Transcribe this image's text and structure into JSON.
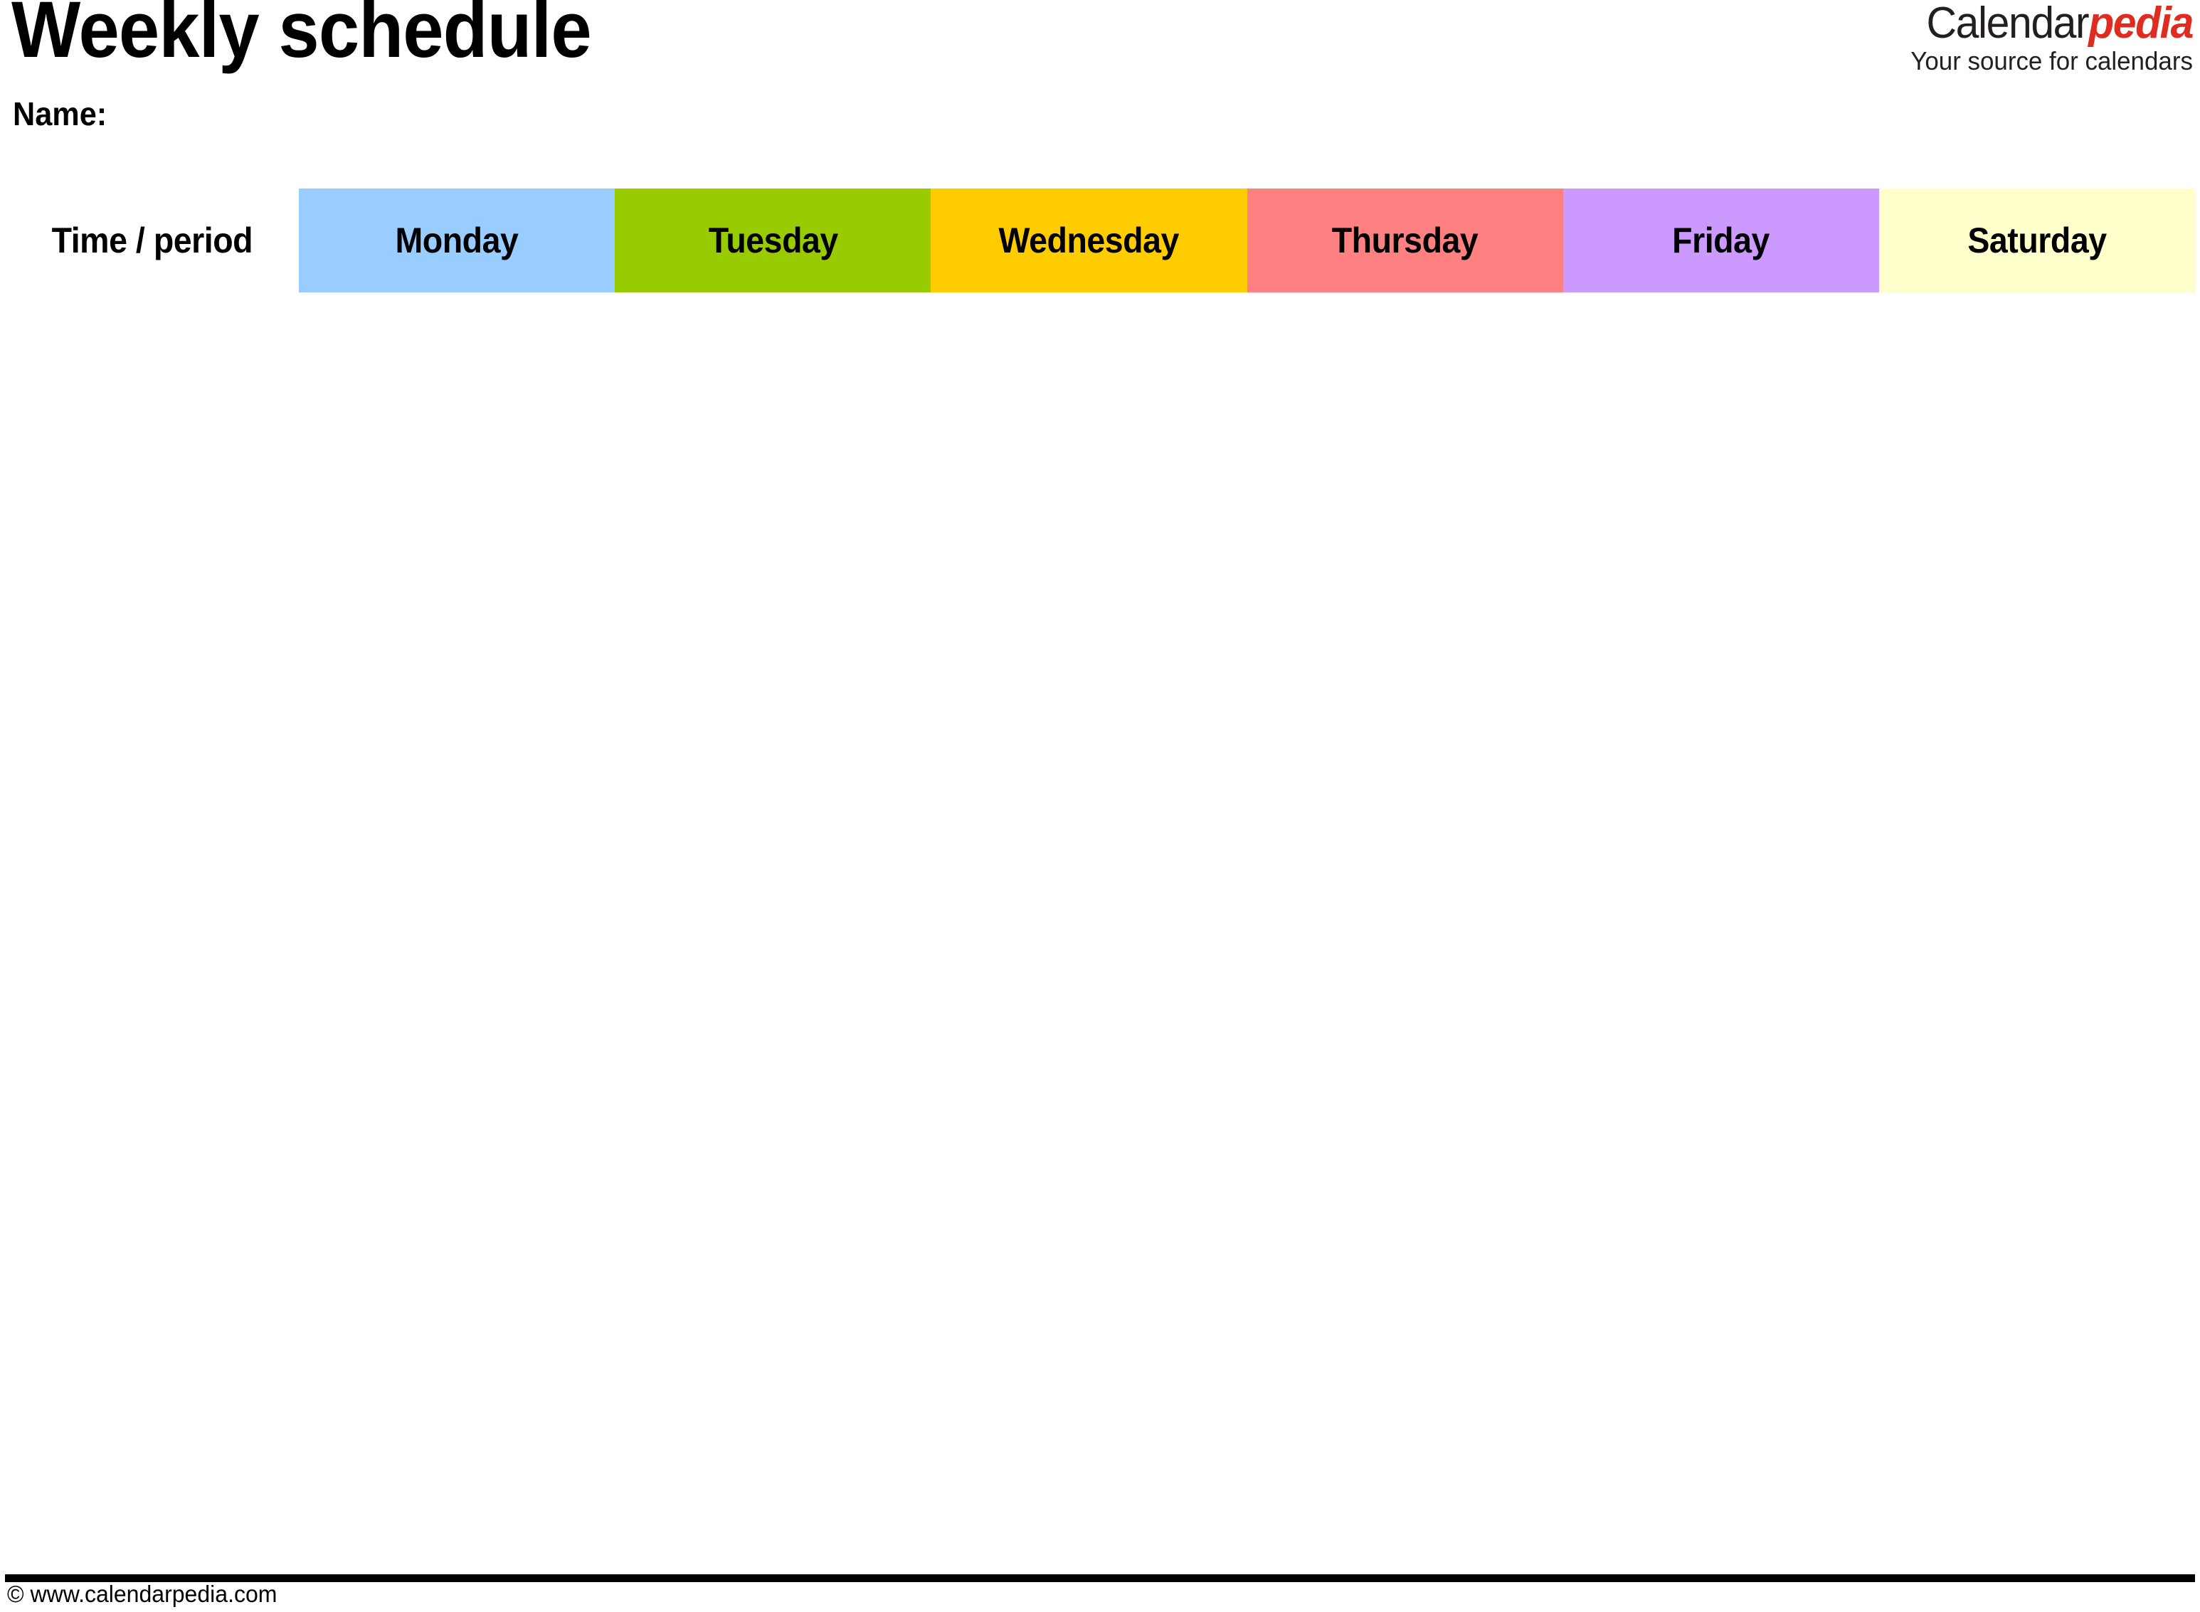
{
  "document": {
    "title": "Weekly schedule",
    "name_label": "Name:"
  },
  "brand": {
    "name_part1": "Calendar",
    "name_part2": "pedia",
    "tagline": "Your source for calendars",
    "accent_color": "#e02b20",
    "text_color": "#231f20"
  },
  "table": {
    "columns": [
      {
        "label": "Time / period",
        "bg": "#ffffff"
      },
      {
        "label": "Monday",
        "bg": "#99ccff"
      },
      {
        "label": "Tuesday",
        "bg": "#99cc00"
      },
      {
        "label": "Wednesday",
        "bg": "#ffcc00"
      },
      {
        "label": "Thursday",
        "bg": "#ff8080"
      },
      {
        "label": "Friday",
        "bg": "#cc99ff"
      },
      {
        "label": "Saturday",
        "bg": "#ffffcc"
      }
    ],
    "row_count": 13,
    "rows": [
      {
        "time": "",
        "monday": "",
        "tuesday": "",
        "wednesday": "",
        "thursday": "",
        "friday": "",
        "saturday": ""
      },
      {
        "time": "",
        "monday": "",
        "tuesday": "",
        "wednesday": "",
        "thursday": "",
        "friday": "",
        "saturday": ""
      },
      {
        "time": "",
        "monday": "",
        "tuesday": "",
        "wednesday": "",
        "thursday": "",
        "friday": "",
        "saturday": ""
      },
      {
        "time": "",
        "monday": "",
        "tuesday": "",
        "wednesday": "",
        "thursday": "",
        "friday": "",
        "saturday": ""
      },
      {
        "time": "",
        "monday": "",
        "tuesday": "",
        "wednesday": "",
        "thursday": "",
        "friday": "",
        "saturday": ""
      },
      {
        "time": "",
        "monday": "",
        "tuesday": "",
        "wednesday": "",
        "thursday": "",
        "friday": "",
        "saturday": ""
      },
      {
        "time": "",
        "monday": "",
        "tuesday": "",
        "wednesday": "",
        "thursday": "",
        "friday": "",
        "saturday": ""
      },
      {
        "time": "",
        "monday": "",
        "tuesday": "",
        "wednesday": "",
        "thursday": "",
        "friday": "",
        "saturday": ""
      },
      {
        "time": "",
        "monday": "",
        "tuesday": "",
        "wednesday": "",
        "thursday": "",
        "friday": "",
        "saturday": ""
      },
      {
        "time": "",
        "monday": "",
        "tuesday": "",
        "wednesday": "",
        "thursday": "",
        "friday": "",
        "saturday": ""
      },
      {
        "time": "",
        "monday": "",
        "tuesday": "",
        "wednesday": "",
        "thursday": "",
        "friday": "",
        "saturday": ""
      },
      {
        "time": "",
        "monday": "",
        "tuesday": "",
        "wednesday": "",
        "thursday": "",
        "friday": "",
        "saturday": ""
      },
      {
        "time": "",
        "monday": "",
        "tuesday": "",
        "wednesday": "",
        "thursday": "",
        "friday": "",
        "saturday": ""
      }
    ]
  },
  "footer": {
    "copyright": "© www.calendarpedia.com"
  }
}
